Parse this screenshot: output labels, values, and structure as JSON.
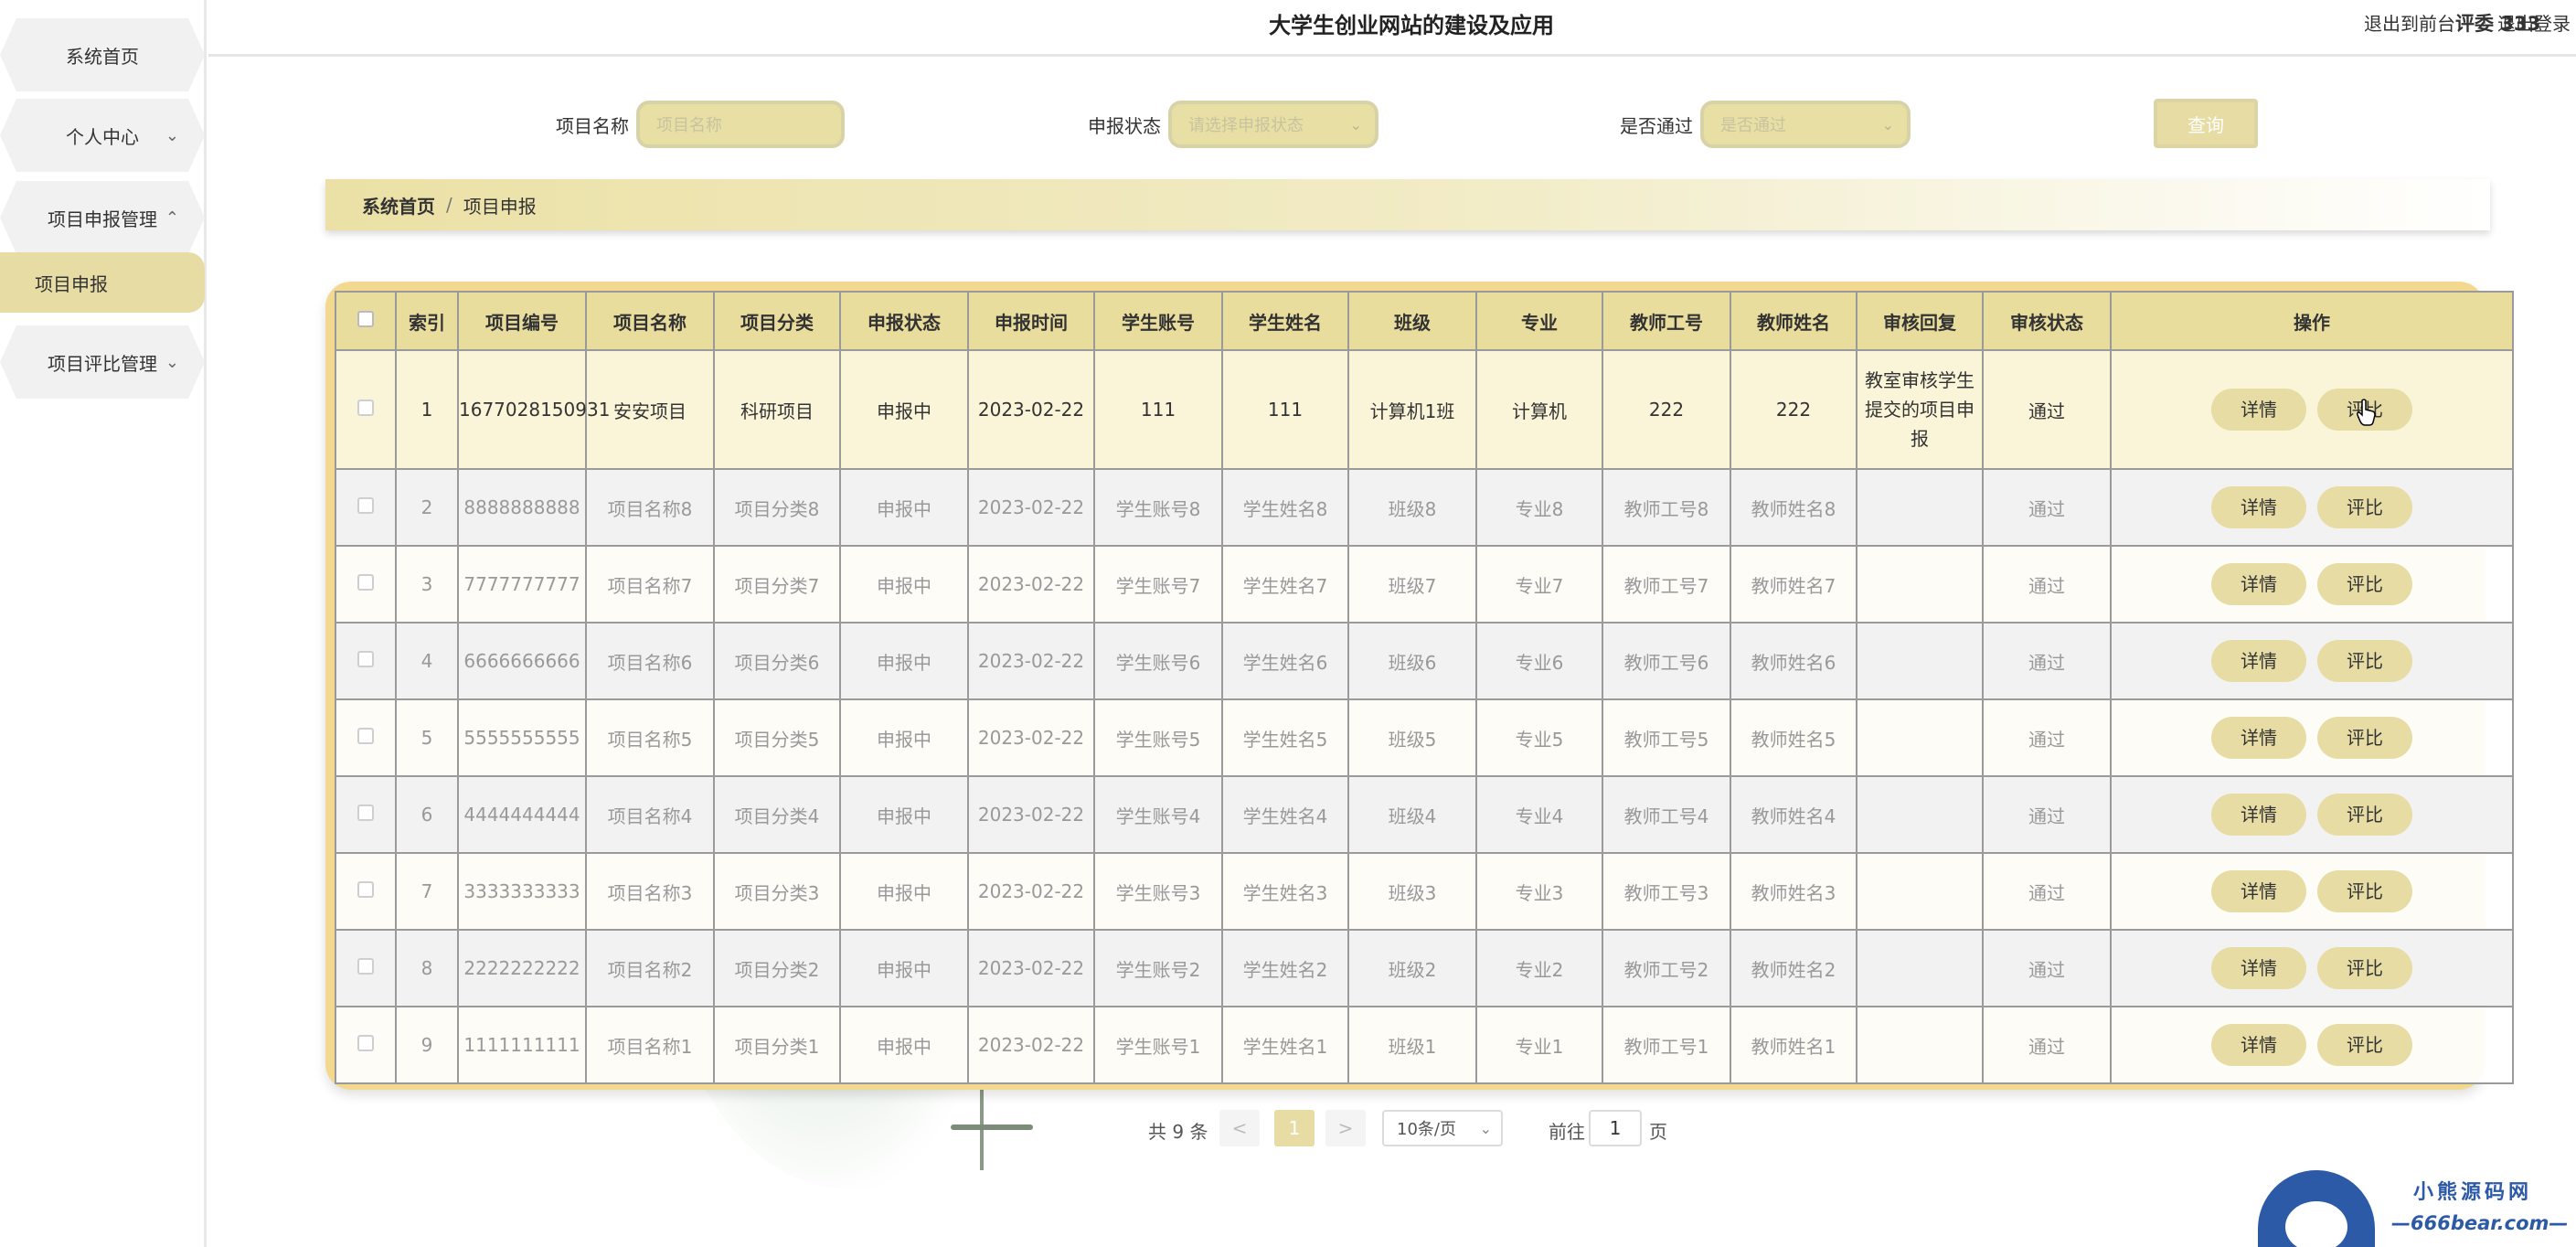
{
  "sidebar": {
    "items": [
      {
        "label": "系统首页",
        "chevron": ""
      },
      {
        "label": "个人中心",
        "chevron": "⌄"
      },
      {
        "label": "项目申报管理",
        "chevron": "⌃"
      },
      {
        "label": "项目申报",
        "chevron": ""
      },
      {
        "label": "项目评比管理",
        "chevron": "⌄"
      }
    ]
  },
  "header": {
    "title": "大学生创业网站的建设及应用",
    "user": "评委 333",
    "back_front": "退出到前台",
    "logout": "退出登录"
  },
  "search": {
    "name_label": "项目名称",
    "name_placeholder": "项目名称",
    "status_label": "申报状态",
    "status_placeholder": "请选择申报状态",
    "pass_label": "是否通过",
    "pass_placeholder": "是否通过",
    "query": "查询"
  },
  "breadcrumb": {
    "home": "系统首页",
    "sep": "/",
    "current": "项目申报"
  },
  "table": {
    "headers": [
      "索引",
      "项目编号",
      "项目名称",
      "项目分类",
      "申报状态",
      "申报时间",
      "学生账号",
      "学生姓名",
      "班级",
      "专业",
      "教师工号",
      "教师姓名",
      "审核回复",
      "审核状态",
      "操作"
    ],
    "detail_label": "详情",
    "compare_label": "评比",
    "rows": [
      {
        "idx": "1",
        "code": "1677028150931",
        "name": "安安项目",
        "cat": "科研项目",
        "status": "申报中",
        "date": "2023-02-22",
        "sacc": "111",
        "sname": "111",
        "cls": "计算机1班",
        "major": "计算机",
        "tno": "222",
        "tname": "222",
        "reply": "教室审核学生提交的项目申报",
        "audit": "通过"
      },
      {
        "idx": "2",
        "code": "8888888888",
        "name": "项目名称8",
        "cat": "项目分类8",
        "status": "申报中",
        "date": "2023-02-22",
        "sacc": "学生账号8",
        "sname": "学生姓名8",
        "cls": "班级8",
        "major": "专业8",
        "tno": "教师工号8",
        "tname": "教师姓名8",
        "reply": "",
        "audit": "通过"
      },
      {
        "idx": "3",
        "code": "7777777777",
        "name": "项目名称7",
        "cat": "项目分类7",
        "status": "申报中",
        "date": "2023-02-22",
        "sacc": "学生账号7",
        "sname": "学生姓名7",
        "cls": "班级7",
        "major": "专业7",
        "tno": "教师工号7",
        "tname": "教师姓名7",
        "reply": "",
        "audit": "通过"
      },
      {
        "idx": "4",
        "code": "6666666666",
        "name": "项目名称6",
        "cat": "项目分类6",
        "status": "申报中",
        "date": "2023-02-22",
        "sacc": "学生账号6",
        "sname": "学生姓名6",
        "cls": "班级6",
        "major": "专业6",
        "tno": "教师工号6",
        "tname": "教师姓名6",
        "reply": "",
        "audit": "通过"
      },
      {
        "idx": "5",
        "code": "5555555555",
        "name": "项目名称5",
        "cat": "项目分类5",
        "status": "申报中",
        "date": "2023-02-22",
        "sacc": "学生账号5",
        "sname": "学生姓名5",
        "cls": "班级5",
        "major": "专业5",
        "tno": "教师工号5",
        "tname": "教师姓名5",
        "reply": "",
        "audit": "通过"
      },
      {
        "idx": "6",
        "code": "4444444444",
        "name": "项目名称4",
        "cat": "项目分类4",
        "status": "申报中",
        "date": "2023-02-22",
        "sacc": "学生账号4",
        "sname": "学生姓名4",
        "cls": "班级4",
        "major": "专业4",
        "tno": "教师工号4",
        "tname": "教师姓名4",
        "reply": "",
        "audit": "通过"
      },
      {
        "idx": "7",
        "code": "3333333333",
        "name": "项目名称3",
        "cat": "项目分类3",
        "status": "申报中",
        "date": "2023-02-22",
        "sacc": "学生账号3",
        "sname": "学生姓名3",
        "cls": "班级3",
        "major": "专业3",
        "tno": "教师工号3",
        "tname": "教师姓名3",
        "reply": "",
        "audit": "通过"
      },
      {
        "idx": "8",
        "code": "2222222222",
        "name": "项目名称2",
        "cat": "项目分类2",
        "status": "申报中",
        "date": "2023-02-22",
        "sacc": "学生账号2",
        "sname": "学生姓名2",
        "cls": "班级2",
        "major": "专业2",
        "tno": "教师工号2",
        "tname": "教师姓名2",
        "reply": "",
        "audit": "通过"
      },
      {
        "idx": "9",
        "code": "1111111111",
        "name": "项目名称1",
        "cat": "项目分类1",
        "status": "申报中",
        "date": "2023-02-22",
        "sacc": "学生账号1",
        "sname": "学生姓名1",
        "cls": "班级1",
        "major": "专业1",
        "tno": "教师工号1",
        "tname": "教师姓名1",
        "reply": "",
        "audit": "通过"
      }
    ]
  },
  "pagination": {
    "total": "共 9 条",
    "prev": "<",
    "page": "1",
    "next": ">",
    "page_size": "10条/页",
    "goto_prefix": "前往",
    "goto_value": "1",
    "goto_suffix": "页"
  },
  "logo": {
    "line1": "小熊源码网",
    "line2": "—666bear.com—"
  },
  "colors": {
    "accent": "#e6dca4",
    "table_border": "#f3d98f",
    "brand_blue": "#2d5aa6"
  }
}
